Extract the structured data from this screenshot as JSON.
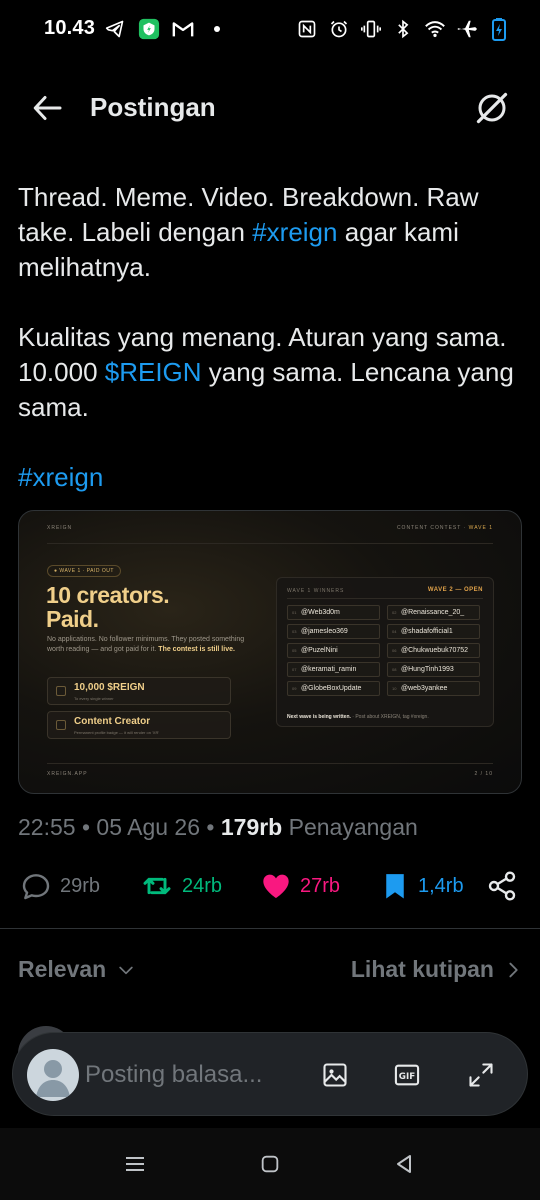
{
  "status_bar": {
    "time": "10.43",
    "icons_left": [
      "telegram-icon",
      "shield-app-icon",
      "gmail-icon",
      "dot-icon"
    ],
    "icons_right": [
      "nfc-icon",
      "alarm-icon",
      "vibrate-icon",
      "bluetooth-icon",
      "wifi-icon",
      "airplane-icon",
      "battery-charging-icon"
    ]
  },
  "header": {
    "title": "Postingan",
    "back_icon": "arrow-left-icon",
    "grok_icon": "grok-icon"
  },
  "post": {
    "line1a": "Thread. Meme. Video. Breakdown. Raw take. Labeli dengan ",
    "hashtag1": "#xreign",
    "line1b": " agar kami melihatnya.",
    "line2a": "Kualitas yang menang. Aturan yang sama. 10.000 ",
    "cashtag": "$REIGN",
    "line2b": " yang sama. Lencana yang sama.",
    "hashtag2": "#xreign"
  },
  "media": {
    "brand": "XREIGN",
    "top_right": "CONTENT CONTEST",
    "top_right_accent": "WAVE 1",
    "pill": "● WAVE 1 · PAID OUT",
    "headline_1": "10 creators.",
    "headline_2": "Paid.",
    "desc": "No applications. No follower minimums. They posted something worth reading — and got paid for it.",
    "desc_bold": "The contest is still live.",
    "box1_title": "10,000 $REIGN",
    "box1_sub": "To every single winner",
    "box2_title": "Content Creator",
    "box2_sub": "Permanent profile badge — it will render on 'XR'",
    "footer_left": "XREIGN.APP",
    "footer_right": "2 / 10",
    "winners_label": "WAVE 1 WINNERS",
    "winners_status": "WAVE 2 — OPEN",
    "winners": [
      {
        "num": "01",
        "handle": "@Web3d0m"
      },
      {
        "num": "02",
        "handle": "@Renaissance_20_"
      },
      {
        "num": "03",
        "handle": "@jamesleo369"
      },
      {
        "num": "04",
        "handle": "@shadafofficial1"
      },
      {
        "num": "05",
        "handle": "@PuzelNini"
      },
      {
        "num": "06",
        "handle": "@Chukwuebuk70752"
      },
      {
        "num": "07",
        "handle": "@keramati_ramin"
      },
      {
        "num": "08",
        "handle": "@HungTinh1993"
      },
      {
        "num": "09",
        "handle": "@GlobeBoxUpdate"
      },
      {
        "num": "10",
        "handle": "@web3yankee"
      }
    ],
    "winners_foot_bold": "Next wave is being written.",
    "winners_foot": " · Post about XREIGN, tag #xreign."
  },
  "meta": {
    "time": "22:55",
    "date": "05 Agu 26",
    "views_count": "179rb",
    "views_label": "Penayangan"
  },
  "actions": {
    "replies": "29rb",
    "reposts": "24rb",
    "likes": "27rb",
    "bookmarks": "1,4rb"
  },
  "sort": {
    "left": "Relevan",
    "right": "Lihat kutipan"
  },
  "composer": {
    "placeholder": "Posting balasa..."
  },
  "colors": {
    "accent": "#1d9bf0",
    "repost": "#00ba7c",
    "like": "#f91880",
    "gold": "#f0cf8a"
  }
}
